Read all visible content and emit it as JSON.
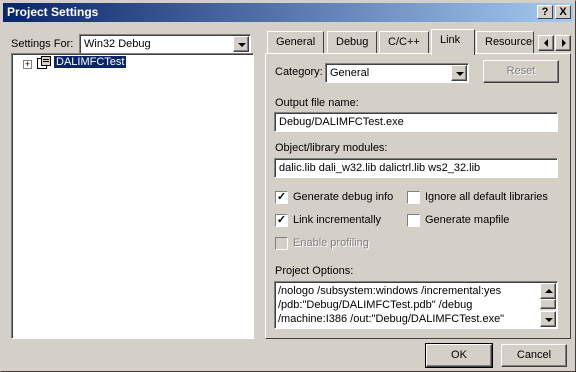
{
  "window": {
    "title": "Project Settings",
    "help_glyph": "?",
    "close_glyph": "X"
  },
  "left": {
    "settings_for_label": "Settings For:",
    "settings_for_value": "Win32 Debug",
    "tree_item": "DALIMFCTest",
    "tree_expander": "+"
  },
  "tabs": [
    {
      "label": "General"
    },
    {
      "label": "Debug"
    },
    {
      "label": "C/C++"
    },
    {
      "label": "Link"
    },
    {
      "label": "Resources"
    }
  ],
  "link": {
    "category_label": "Category:",
    "category_value": "General",
    "reset_label": "Reset",
    "output_file_label": "Output file name:",
    "output_file_value": "Debug/DALIMFCTest.exe",
    "modules_label": "Object/library modules:",
    "modules_value": "dalic.lib dali_w32.lib dalictrl.lib ws2_32.lib",
    "options": [
      {
        "label": "Generate debug info",
        "checked": true,
        "enabled": true
      },
      {
        "label": "Ignore all default libraries",
        "checked": false,
        "enabled": true
      },
      {
        "label": "Link incrementally",
        "checked": true,
        "enabled": true
      },
      {
        "label": "Generate mapfile",
        "checked": false,
        "enabled": true
      },
      {
        "label": "Enable profiling",
        "checked": false,
        "enabled": false
      }
    ],
    "project_options_label": "Project Options:",
    "project_options_lines": [
      "/nologo /subsystem:windows /incremental:yes",
      "/pdb:\"Debug/DALIMFCTest.pdb\" /debug",
      "/machine:I386 /out:\"Debug/DALIMFCTest.exe\""
    ]
  },
  "footer": {
    "ok_label": "OK",
    "cancel_label": "Cancel"
  },
  "colors": {
    "title_start": "#0a246a",
    "title_end": "#a6caf0",
    "face": "#d4d0c8",
    "selection": "#0a246a"
  }
}
